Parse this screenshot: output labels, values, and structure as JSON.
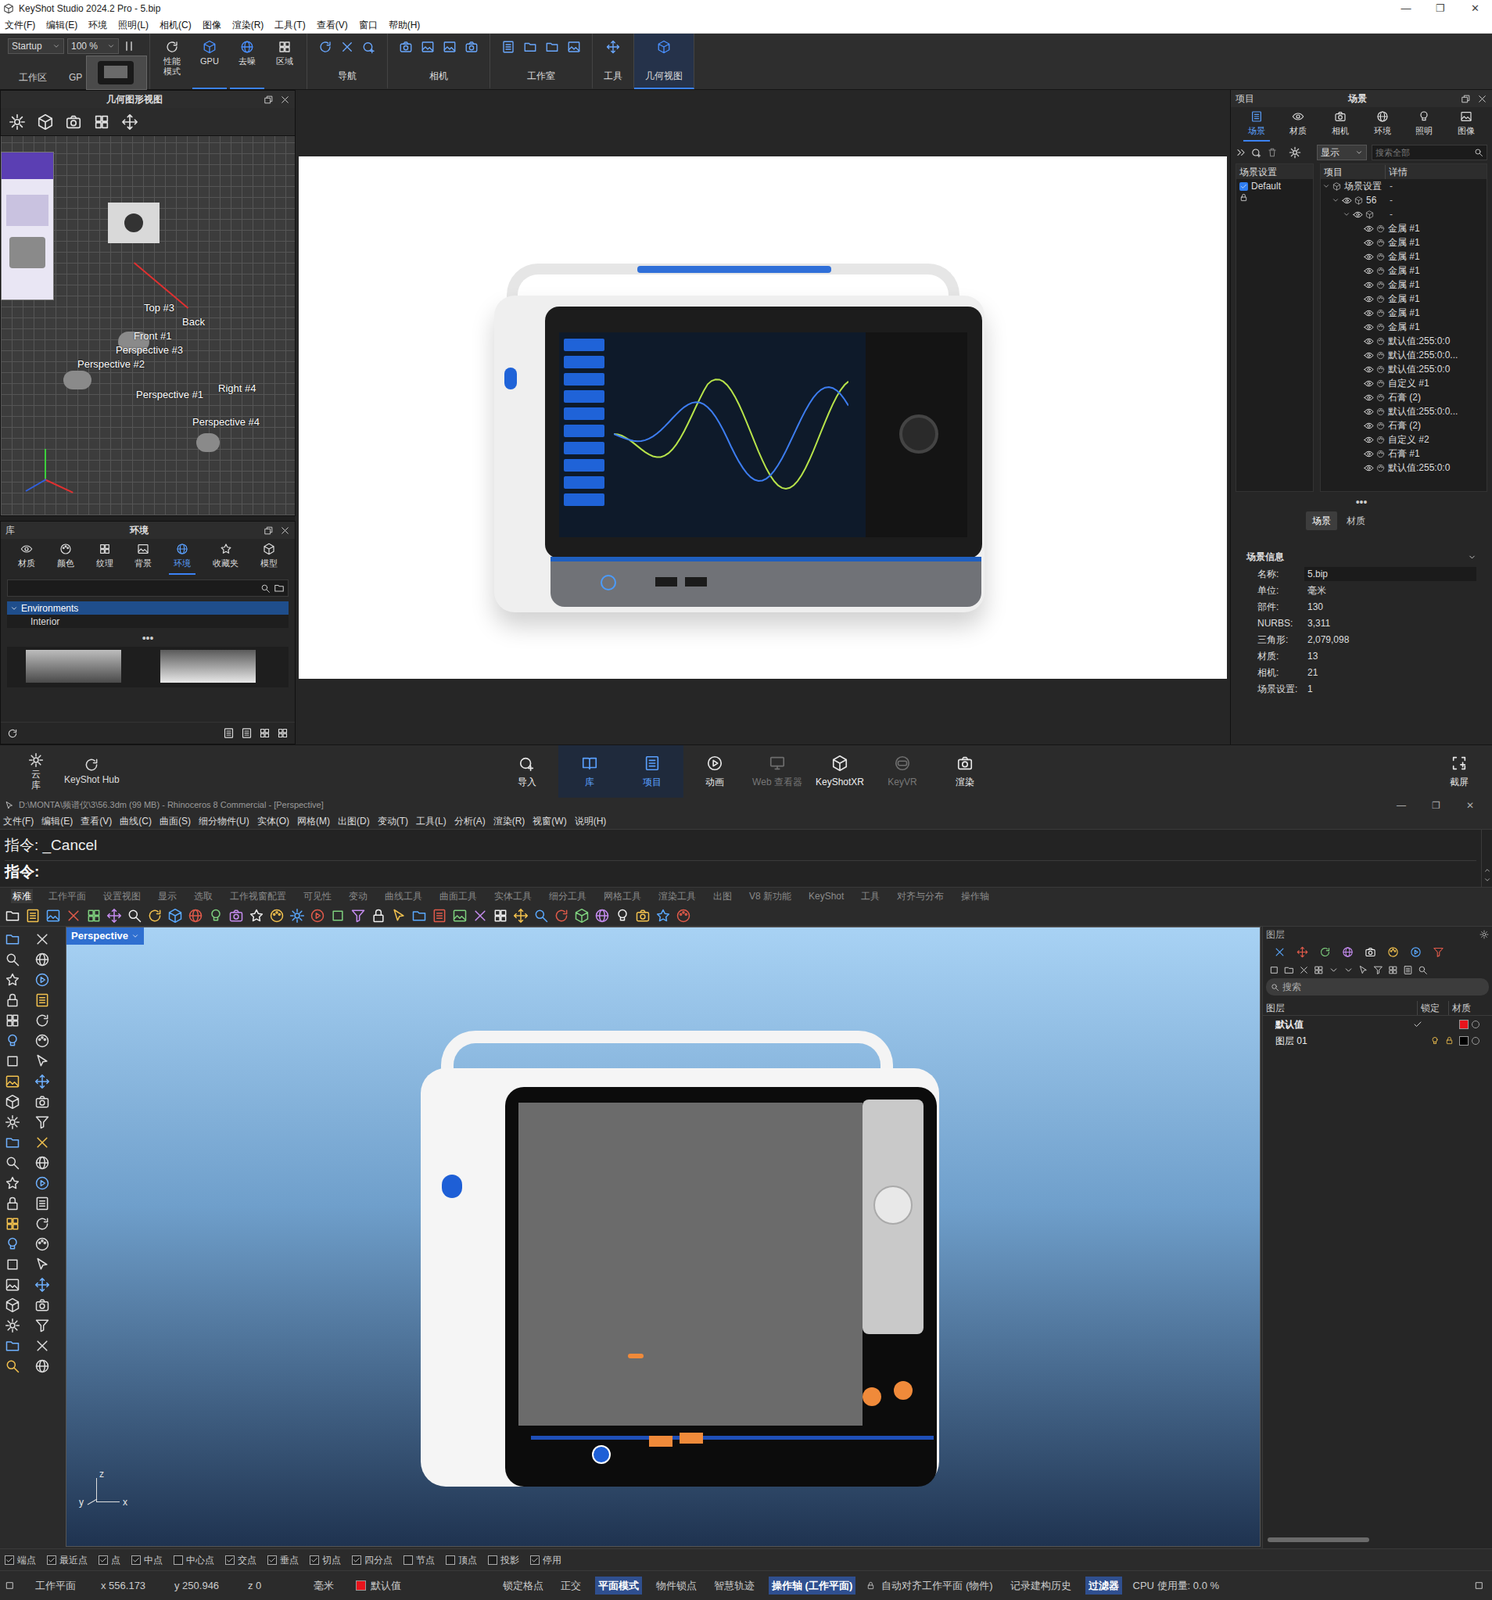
{
  "keyshot": {
    "title": "KeyShot Studio 2024.2 Pro  - 5.bip",
    "window_buttons": [
      "—",
      "❐",
      "✕"
    ],
    "menu": [
      "文件(F)",
      "编辑(E)",
      "环境",
      "照明(L)",
      "相机(C)",
      "图像",
      "渲染(R)",
      "工具(T)",
      "查看(V)",
      "窗口",
      "帮助(H)"
    ],
    "toolbar": {
      "workspace": "Startup",
      "zoom": "100 %",
      "left_labels": [
        "工作区",
        "GP"
      ],
      "modes": [
        {
          "label": "性能模式",
          "selected": false
        },
        {
          "label": "GPU",
          "selected": true
        },
        {
          "label": "去噪",
          "selected": true
        },
        {
          "label": "区域",
          "selected": false
        }
      ],
      "groups": [
        {
          "label": "导航",
          "selected": false
        },
        {
          "label": "相机",
          "selected": false
        },
        {
          "label": "工作室",
          "selected": false
        },
        {
          "label": "工具",
          "selected": false
        },
        {
          "label": "几何视图",
          "selected": true
        }
      ]
    },
    "geometry_view": {
      "title": "几何图形视图",
      "camera_labels": [
        "Top #3",
        "Back",
        "Front #1",
        "Perspective #3",
        "Perspective #2",
        "Perspective #1",
        "Right #4",
        "Perspective #4"
      ]
    },
    "library": {
      "title_left": "库",
      "title": "环境",
      "tabs": [
        {
          "label": "材质",
          "selected": false
        },
        {
          "label": "颜色",
          "selected": false
        },
        {
          "label": "纹理",
          "selected": false
        },
        {
          "label": "背景",
          "selected": false
        },
        {
          "label": "环境",
          "selected": true
        },
        {
          "label": "收藏夹",
          "selected": false
        },
        {
          "label": "模型",
          "selected": false
        }
      ],
      "tree": [
        {
          "label": "Environments",
          "expanded": true,
          "selected": true,
          "children": [
            {
              "label": "Interior",
              "selected": false
            }
          ]
        }
      ],
      "splitter": "•••"
    },
    "project": {
      "title_left": "项目",
      "title": "场景",
      "tabs": [
        {
          "label": "场景",
          "selected": true
        },
        {
          "label": "材质",
          "selected": false
        },
        {
          "label": "相机",
          "selected": false
        },
        {
          "label": "环境",
          "selected": false
        },
        {
          "label": "照明",
          "selected": false
        },
        {
          "label": "图像",
          "selected": false
        }
      ],
      "filter": "显示",
      "search_placeholder": "搜索全部",
      "scene_sets_header": "场景设置",
      "scene_sets": [
        {
          "label": "Default",
          "checked": true
        }
      ],
      "columns": [
        "项目",
        "详情"
      ],
      "tree": [
        {
          "label": "场景设置",
          "detail": "-",
          "expanded": true,
          "children": [
            {
              "label": "56",
              "detail": "-",
              "expanded": true,
              "children": [
                {
                  "detail": "-",
                  "expanded": true,
                  "children": [
                    {
                      "label": "金属 #1"
                    },
                    {
                      "label": "金属 #1"
                    },
                    {
                      "label": "金属 #1"
                    },
                    {
                      "label": "金属 #1"
                    },
                    {
                      "label": "金属 #1"
                    },
                    {
                      "label": "金属 #1"
                    },
                    {
                      "label": "金属 #1"
                    },
                    {
                      "label": "金属 #1"
                    },
                    {
                      "label": "默认值:255:0:0"
                    },
                    {
                      "label": "默认值:255:0:0..."
                    },
                    {
                      "label": "默认值:255:0:0"
                    },
                    {
                      "label": "自定义 #1"
                    },
                    {
                      "label": "石膏 (2)"
                    },
                    {
                      "label": "默认值:255:0:0..."
                    },
                    {
                      "label": "石膏 (2)"
                    },
                    {
                      "label": "自定义 #2"
                    },
                    {
                      "label": "石膏 #1"
                    },
                    {
                      "label": "默认值:255:0:0"
                    }
                  ]
                }
              ]
            }
          ]
        }
      ],
      "splitter": "•••",
      "bottom_tabs": [
        {
          "label": "场景",
          "selected": true
        },
        {
          "label": "材质",
          "selected": false
        }
      ],
      "info_title": "场景信息",
      "info": [
        {
          "key": "名称:",
          "value": "5.bip"
        },
        {
          "key": "单位:",
          "value": "毫米"
        },
        {
          "key": "部件:",
          "value": "130"
        },
        {
          "key": "NURBS:",
          "value": "3,311"
        },
        {
          "key": "三角形:",
          "value": "2,079,098"
        },
        {
          "key": "材质:",
          "value": "13"
        },
        {
          "key": "相机:",
          "value": "21"
        },
        {
          "key": "场景设置:",
          "value": "1"
        }
      ]
    },
    "bottom_bar": {
      "left": [
        {
          "label": "云库",
          "kind": "vertical"
        },
        {
          "label": "KeyShot Hub",
          "kind": "normal"
        }
      ],
      "center": [
        {
          "label": "导入",
          "selected": false,
          "disabled": false
        },
        {
          "label": "库",
          "selected": true,
          "disabled": false
        },
        {
          "label": "项目",
          "selected": true,
          "disabled": false
        },
        {
          "label": "动画",
          "selected": false,
          "disabled": false
        },
        {
          "label": "Web 查看器",
          "selected": false,
          "disabled": true
        },
        {
          "label": "KeyShotXR",
          "selected": false,
          "disabled": false
        },
        {
          "label": "KeyVR",
          "selected": false,
          "disabled": true
        },
        {
          "label": "渲染",
          "selected": false,
          "disabled": false
        }
      ],
      "right": [
        {
          "label": "截屏"
        }
      ]
    }
  },
  "rhino": {
    "title": "D:\\MONTA\\频谱仪\\3\\56.3dm (99 MB) - Rhinoceros 8 Commercial - [Perspective]",
    "window_buttons": [
      "—",
      "❐",
      "✕"
    ],
    "menu": [
      "文件(F)",
      "编辑(E)",
      "查看(V)",
      "曲线(C)",
      "曲面(S)",
      "细分物件(U)",
      "实体(O)",
      "网格(M)",
      "出图(D)",
      "变动(T)",
      "工具(L)",
      "分析(A)",
      "渲染(R)",
      "视窗(W)",
      "说明(H)"
    ],
    "command_history": "指令: _Cancel",
    "command_prompt": "指令:",
    "tabs": [
      {
        "label": "标准",
        "selected": true
      },
      {
        "label": "工作平面",
        "selected": false
      },
      {
        "label": "设置视图",
        "selected": false
      },
      {
        "label": "显示",
        "selected": false
      },
      {
        "label": "选取",
        "selected": false
      },
      {
        "label": "工作视窗配置",
        "selected": false
      },
      {
        "label": "可见性",
        "selected": false
      },
      {
        "label": "变动",
        "selected": false
      },
      {
        "label": "曲线工具",
        "selected": false
      },
      {
        "label": "曲面工具",
        "selected": false
      },
      {
        "label": "实体工具",
        "selected": false
      },
      {
        "label": "细分工具",
        "selected": false
      },
      {
        "label": "网格工具",
        "selected": false
      },
      {
        "label": "渲染工具",
        "selected": false
      },
      {
        "label": "出图",
        "selected": false
      },
      {
        "label": "V8 新功能",
        "selected": false
      },
      {
        "label": "KeyShot",
        "selected": false
      },
      {
        "label": "工具",
        "selected": false
      },
      {
        "label": "对齐与分布",
        "selected": false
      },
      {
        "label": "操作轴",
        "selected": false
      }
    ],
    "viewport": {
      "label": "Perspective",
      "axes": [
        "z",
        "y",
        "x"
      ]
    },
    "layers": {
      "title": "图层",
      "search_placeholder": "搜索",
      "columns": [
        "图层",
        "锁定",
        "材质"
      ],
      "rows": [
        {
          "name": "默认值",
          "current": true,
          "color": "#e8141c"
        },
        {
          "name": "图层 01",
          "current": false,
          "color": "#000000"
        }
      ]
    },
    "osnaps": [
      {
        "label": "端点",
        "checked": true
      },
      {
        "label": "最近点",
        "checked": true
      },
      {
        "label": "点",
        "checked": true
      },
      {
        "label": "中点",
        "checked": true
      },
      {
        "label": "中心点",
        "checked": false
      },
      {
        "label": "交点",
        "checked": true
      },
      {
        "label": "垂点",
        "checked": true
      },
      {
        "label": "切点",
        "checked": true
      },
      {
        "label": "四分点",
        "checked": true
      },
      {
        "label": "节点",
        "checked": false
      },
      {
        "label": "顶点",
        "checked": false
      },
      {
        "label": "投影",
        "checked": false
      },
      {
        "label": "停用",
        "checked": true
      }
    ],
    "status": {
      "plane": "工作平面",
      "x": "x 556.173",
      "y": "y 250.946",
      "z": "z 0",
      "units": "毫米",
      "layer": "默认值",
      "layer_color": "#e8141c",
      "toggles": [
        {
          "label": "锁定格点",
          "selected": false
        },
        {
          "label": "正交",
          "selected": false
        },
        {
          "label": "平面模式",
          "selected": true
        },
        {
          "label": "物件锁点",
          "selected": false
        },
        {
          "label": "智慧轨迹",
          "selected": false
        },
        {
          "label": "操作轴 (工作平面)",
          "selected": true
        },
        {
          "label": "自动对齐工作平面 (物件)",
          "selected": false
        },
        {
          "label": "记录建构历史",
          "selected": false
        },
        {
          "label": "过滤器",
          "selected": true
        }
      ],
      "cpu": "CPU 使用量: 0.0 %"
    }
  }
}
